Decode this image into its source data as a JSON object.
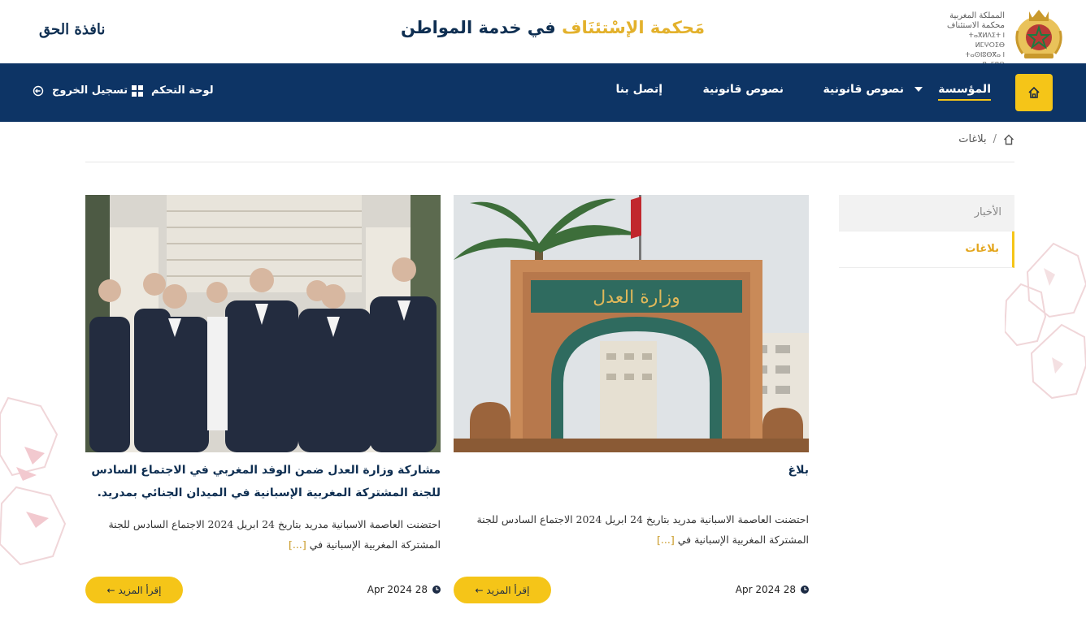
{
  "header": {
    "logo_lines": [
      "المملكة المغربية",
      "محكمة الاستئناف",
      "ⵜⴰⴳⵍⴷⵉⵜ ⵏ ⵍⵎⵖⵔⵉⴱ",
      "ⵜⴰⵙⵏⵓⴱⴳⴰ ⵏ ⵓⴰⵎⵓⵔ"
    ],
    "title_gold": "مَحكمة الإسْتئنَاف",
    "title_rest": "في خدمة المواطن",
    "brand_left": "نافذة الحق"
  },
  "nav": {
    "home_icon": "home-icon",
    "items": [
      {
        "label": "المؤسسة",
        "dropdown": true,
        "active": true
      },
      {
        "label": "نصوص قانونية"
      },
      {
        "label": "نصوص قانونية"
      },
      {
        "label": "إتصل بنا"
      }
    ],
    "dashboard_label": "لوحة التحكم",
    "logout_label": "تسجيل الخروج"
  },
  "breadcrumb": {
    "current": "بلاغات"
  },
  "sidebar": {
    "items": [
      {
        "label": "الأخبار",
        "active": false
      },
      {
        "label": "بلاغات",
        "active": true
      }
    ]
  },
  "cards": [
    {
      "title": "بلاغ",
      "excerpt": "احتضنت العاصمة الاسبانية مدريد بتاريخ 24 ابريل 2024 الاجتماع السادس للجنة المشتركة المغربية الإسبانية في",
      "more": "[...]",
      "date": "28 2024 Apr",
      "button": "إقرأ المزيد ←"
    },
    {
      "title": "مشاركة وزارة العدل ضمن الوفد المغربي في الاجتماع السادس للجنة المشتركة المغربية الإسبانية في الميدان الجنائي بمدريد.",
      "excerpt": "احتضنت العاصمة الاسبانية مدريد بتاريخ 24 ابريل 2024 الاجتماع السادس للجنة المشتركة المغربية الإسبانية في",
      "more": "[...]",
      "date": "28 2024 Apr",
      "button": "إقرأ المزيد ←"
    }
  ],
  "image_text": {
    "gate_sign": "وزارة العدل"
  },
  "colors": {
    "navy": "#0d3465",
    "gold": "#f5c518",
    "title_navy": "#0f2f52"
  }
}
